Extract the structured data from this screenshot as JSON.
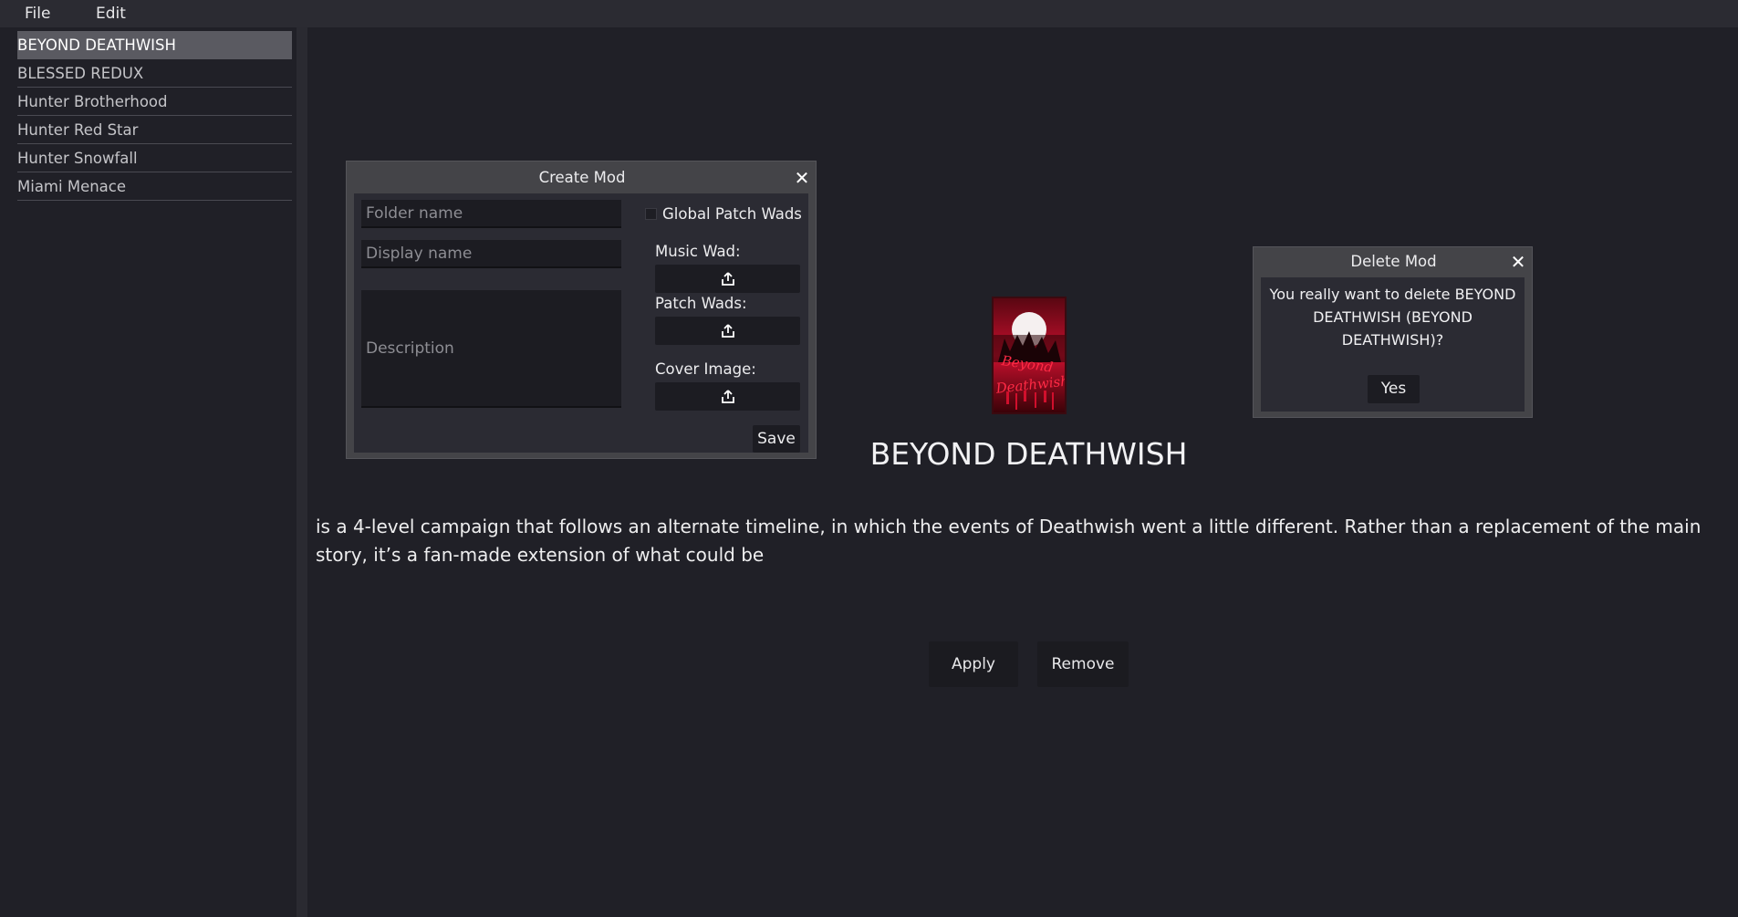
{
  "menubar": {
    "file": "File",
    "edit": "Edit"
  },
  "sidebar": {
    "items": [
      {
        "label": "BEYOND DEATHWISH",
        "selected": true
      },
      {
        "label": "BLESSED REDUX",
        "selected": false
      },
      {
        "label": "Hunter Brotherhood",
        "selected": false
      },
      {
        "label": "Hunter Red Star",
        "selected": false
      },
      {
        "label": "Hunter Snowfall",
        "selected": false
      },
      {
        "label": "Miami Menace",
        "selected": false
      }
    ]
  },
  "main": {
    "cover_lettering": "Beyond Deathwish",
    "title": "BEYOND DEATHWISH",
    "description": "is a 4-level campaign that follows an alternate timeline, in which the events of Deathwish went a little different. Rather than a replacement of the main story, it’s a fan-made extension of what could be",
    "apply_label": "Apply",
    "remove_label": "Remove"
  },
  "create_mod": {
    "title": "Create Mod",
    "folder_placeholder": "Folder name",
    "display_placeholder": "Display name",
    "description_placeholder": "Description",
    "global_patch_label": "Global Patch Wads",
    "global_patch_checked": false,
    "music_wad_label": "Music Wad:",
    "patch_wads_label": "Patch Wads:",
    "cover_image_label": "Cover Image:",
    "save_label": "Save"
  },
  "delete_mod": {
    "title": "Delete Mod",
    "message": "You really want to delete BEYOND DEATHWISH (BEYOND DEATHWISH)?",
    "yes_label": "Yes"
  },
  "icons": {
    "close": "close-icon",
    "upload": "upload-icon"
  },
  "colors": {
    "background": "#202027",
    "selected_item": "#5a5a61",
    "dialog_frame": "#444448",
    "cover_red": "#c8102e"
  }
}
